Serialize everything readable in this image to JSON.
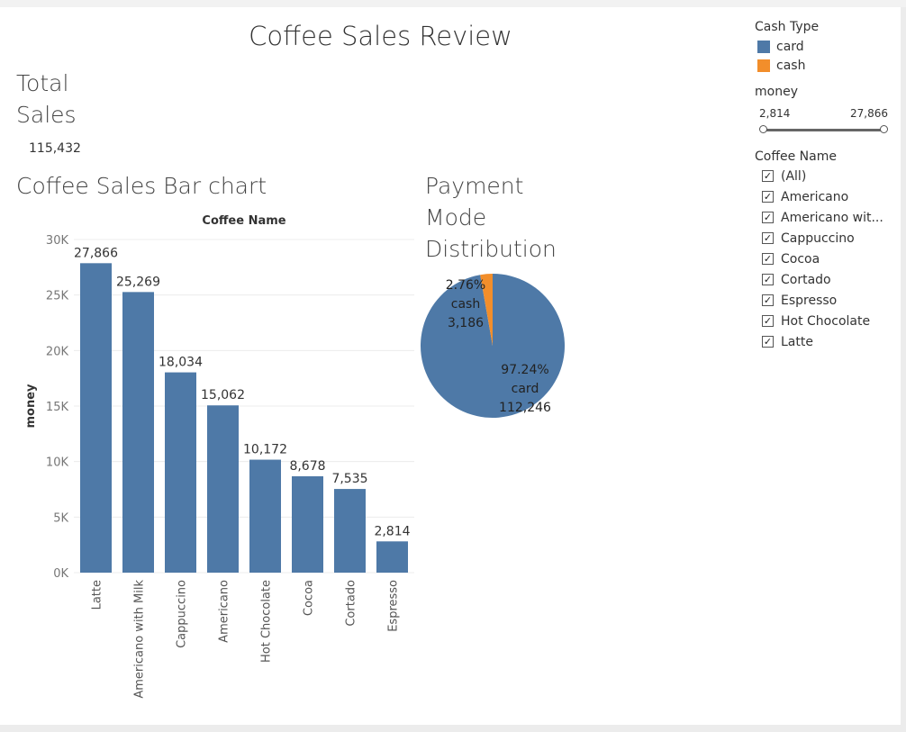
{
  "dashboard": {
    "title": "Coffee Sales Review",
    "total_sales_heading": [
      "Total",
      "Sales"
    ],
    "total_sales_value": "115,432",
    "bar_heading": "Coffee Sales Bar chart",
    "pie_heading": [
      "Payment",
      "Mode",
      "Distribution"
    ]
  },
  "legend": {
    "title": "Cash Type",
    "items": [
      {
        "label": "card",
        "color": "#4e79a7"
      },
      {
        "label": "cash",
        "color": "#f28e2b"
      }
    ]
  },
  "money_filter": {
    "title": "money",
    "min_label": "2,814",
    "max_label": "27,866"
  },
  "coffee_filter": {
    "title": "Coffee Name",
    "items": [
      {
        "label": "(All)",
        "checked": true
      },
      {
        "label": "Americano",
        "checked": true
      },
      {
        "label": "Americano wit...",
        "checked": true
      },
      {
        "label": "Cappuccino",
        "checked": true
      },
      {
        "label": "Cocoa",
        "checked": true
      },
      {
        "label": "Cortado",
        "checked": true
      },
      {
        "label": "Espresso",
        "checked": true
      },
      {
        "label": "Hot Chocolate",
        "checked": true
      },
      {
        "label": "Latte",
        "checked": true
      }
    ]
  },
  "chart_data": [
    {
      "type": "bar",
      "title": "Coffee Sales Bar chart",
      "xlabel": "Coffee Name",
      "ylabel": "money",
      "categories": [
        "Latte",
        "Americano with Milk",
        "Cappuccino",
        "Americano",
        "Hot Chocolate",
        "Cocoa",
        "Cortado",
        "Espresso"
      ],
      "values": [
        27866,
        25269,
        18034,
        15062,
        10172,
        8678,
        7535,
        2814
      ],
      "value_labels": [
        "27,866",
        "25,269",
        "18,034",
        "15,062",
        "10,172",
        "8,678",
        "7,535",
        "2,814"
      ],
      "yticks": [
        0,
        5000,
        10000,
        15000,
        20000,
        25000,
        30000
      ],
      "ytick_labels": [
        "0K",
        "5K",
        "10K",
        "15K",
        "20K",
        "25K",
        "30K"
      ],
      "ylim": [
        0,
        30000
      ],
      "color": "#4e79a7",
      "grid": true
    },
    {
      "type": "pie",
      "title": "Payment Mode Distribution",
      "slices": [
        {
          "label": "card",
          "value": 112246,
          "value_label": "112,246",
          "percent_label": "97.24%",
          "color": "#4e79a7"
        },
        {
          "label": "cash",
          "value": 3186,
          "value_label": "3,186",
          "percent_label": "2.76%",
          "color": "#f28e2b"
        }
      ]
    }
  ]
}
